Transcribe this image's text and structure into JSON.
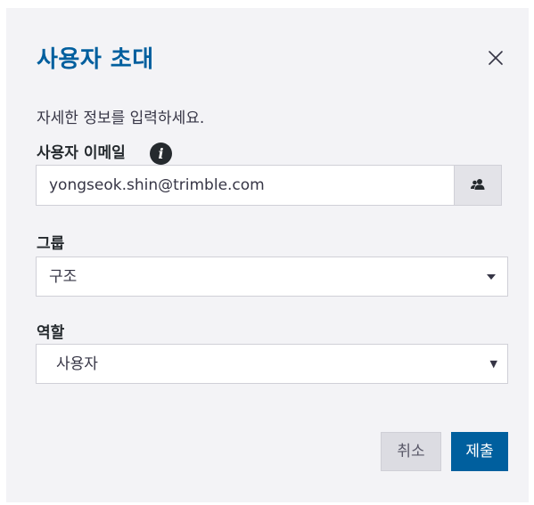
{
  "dialog": {
    "title": "사용자 초대",
    "close_icon": "close-icon",
    "subtitle": "자세한 정보를 입력하세요.",
    "email": {
      "label": "사용자 이메일",
      "info_icon": "info-icon",
      "info_glyph": "i",
      "value": "yongseok.shin@trimble.com",
      "people_icon": "people-icon"
    },
    "group": {
      "label": "그룹",
      "selected": "구조"
    },
    "role": {
      "label": "역할",
      "selected": "사용자",
      "caret_glyph": "▼"
    },
    "buttons": {
      "cancel": "취소",
      "submit": "제출"
    },
    "colors": {
      "primary": "#005f9e",
      "background": "#f3f3f6",
      "text": "#252a2e"
    }
  }
}
